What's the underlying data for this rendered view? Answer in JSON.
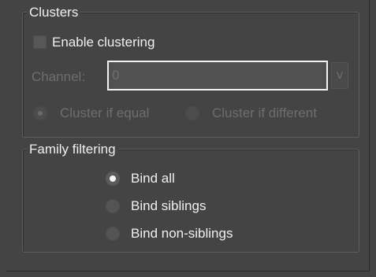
{
  "clusters": {
    "title": "Clusters",
    "enable_label": "Enable clustering",
    "enable_checked": false,
    "channel_label": "Channel:",
    "channel_value": "0",
    "dropdown_label": "v",
    "cluster_equal_label": "Cluster if equal",
    "cluster_different_label": "Cluster if different",
    "selected_mode": "Cluster if equal"
  },
  "family_filtering": {
    "title": "Family filtering",
    "options": [
      {
        "label": "Bind all",
        "selected": true
      },
      {
        "label": "Bind siblings",
        "selected": false
      },
      {
        "label": "Bind non-siblings",
        "selected": false
      }
    ]
  }
}
